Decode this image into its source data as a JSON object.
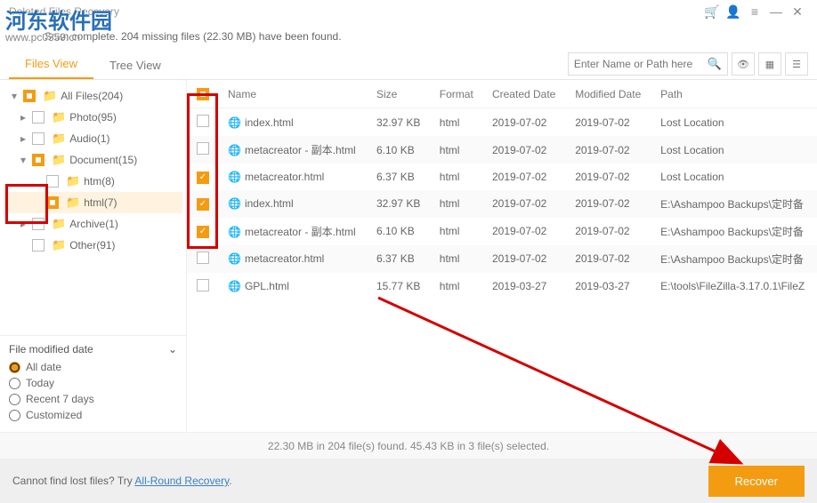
{
  "titlebar": {
    "title": "Deleted Files Recovery"
  },
  "scan": {
    "text": "Scan complete. 204 missing files (22.30 MB) have been found."
  },
  "tabs": {
    "files": "Files View",
    "tree": "Tree View"
  },
  "search": {
    "placeholder": "Enter Name or Path here"
  },
  "sidebar": {
    "items": [
      {
        "label": "All Files(204)",
        "depth": 0,
        "partial": true,
        "expander": "▾"
      },
      {
        "label": "Photo(95)",
        "depth": 1,
        "partial": false,
        "expander": "▸"
      },
      {
        "label": "Audio(1)",
        "depth": 1,
        "partial": false,
        "expander": "▸"
      },
      {
        "label": "Document(15)",
        "depth": 1,
        "partial": true,
        "expander": "▾"
      },
      {
        "label": "htm(8)",
        "depth": 2,
        "partial": false,
        "expander": ""
      },
      {
        "label": "html(7)",
        "depth": 2,
        "partial": true,
        "expander": "",
        "selected": true
      },
      {
        "label": "Archive(1)",
        "depth": 1,
        "partial": false,
        "expander": "▸"
      },
      {
        "label": "Other(91)",
        "depth": 1,
        "partial": false,
        "expander": ""
      }
    ]
  },
  "filter": {
    "header": "File modified date",
    "options": [
      "All date",
      "Today",
      "Recent 7 days",
      "Customized"
    ],
    "selected": 0
  },
  "columns": {
    "c0": "",
    "c1": "Name",
    "c2": "Size",
    "c3": "Format",
    "c4": "Created Date",
    "c5": "Modified Date",
    "c6": "Path"
  },
  "rows": [
    {
      "ck": false,
      "name": "index.html",
      "size": "32.97 KB",
      "format": "html",
      "created": "2019-07-02",
      "modified": "2019-07-02",
      "path": "Lost Location"
    },
    {
      "ck": false,
      "name": "metacreator - 副本.html",
      "size": "6.10 KB",
      "format": "html",
      "created": "2019-07-02",
      "modified": "2019-07-02",
      "path": "Lost Location"
    },
    {
      "ck": true,
      "name": "metacreator.html",
      "size": "6.37 KB",
      "format": "html",
      "created": "2019-07-02",
      "modified": "2019-07-02",
      "path": "Lost Location"
    },
    {
      "ck": true,
      "name": "index.html",
      "size": "32.97 KB",
      "format": "html",
      "created": "2019-07-02",
      "modified": "2019-07-02",
      "path": "E:\\Ashampoo Backups\\定时备"
    },
    {
      "ck": true,
      "name": "metacreator - 副本.html",
      "size": "6.10 KB",
      "format": "html",
      "created": "2019-07-02",
      "modified": "2019-07-02",
      "path": "E:\\Ashampoo Backups\\定时备"
    },
    {
      "ck": false,
      "name": "metacreator.html",
      "size": "6.37 KB",
      "format": "html",
      "created": "2019-07-02",
      "modified": "2019-07-02",
      "path": "E:\\Ashampoo Backups\\定时备"
    },
    {
      "ck": false,
      "name": "GPL.html",
      "size": "15.77 KB",
      "format": "html",
      "created": "2019-03-27",
      "modified": "2019-03-27",
      "path": "E:\\tools\\FileZilla-3.17.0.1\\FileZ"
    }
  ],
  "statusbar": {
    "text": "22.30 MB in 204 file(s) found. 45.43 KB in 3 file(s) selected."
  },
  "footer": {
    "hint_prefix": "Cannot find lost files? Try ",
    "hint_link": "All-Round Recovery",
    "hint_suffix": ".",
    "recover": "Recover"
  },
  "watermark": {
    "main": "河东软件园",
    "sub": "www.pc0359.cn"
  }
}
